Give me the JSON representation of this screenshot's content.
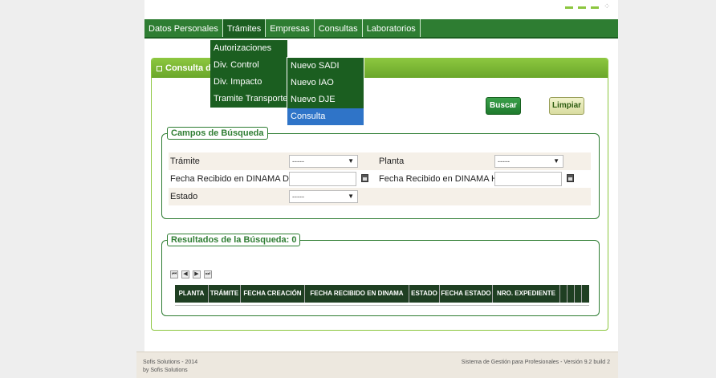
{
  "menu": {
    "items": [
      "Datos Personales",
      "Trámites",
      "Empresas",
      "Consultas",
      "Laboratorios"
    ]
  },
  "tramites_menu": [
    "Autorizaciones",
    "Div. Control",
    "Div. Impacto",
    "Tramite Transporte"
  ],
  "div_control_submenu": [
    "Nuevo SADI",
    "Nuevo IAO",
    "Nuevo DJE",
    "Consulta"
  ],
  "panel": {
    "title": "Consulta de T"
  },
  "buttons": {
    "buscar": "Buscar",
    "limpiar": "Limpiar"
  },
  "campos": {
    "legend": "Campos de Búsqueda",
    "tramite_label": "Trámite",
    "tramite_value": "-----",
    "planta_label": "Planta",
    "planta_value": "-----",
    "fecha_desde_label": "Fecha Recibido en DINAMA Desde",
    "fecha_hasta_label": "Fecha Recibido en DINAMA Hasta",
    "estado_label": "Estado",
    "estado_value": "-----"
  },
  "resultados": {
    "legend": "Resultados de la Búsqueda: 0",
    "pager": [
      "⏮",
      "◀",
      "▶",
      "⏭"
    ],
    "columns": [
      "PLANTA",
      "TRÁMITE",
      "FECHA CREACIÓN",
      "FECHA RECIBIDO EN DINAMA",
      "ESTADO",
      "FECHA ESTADO",
      "NRO. EXPEDIENTE"
    ]
  },
  "footer": {
    "left_line1": "Sofis Solutions - 2014",
    "left_line2": "by Sofis Solutions",
    "right": "Sistema de Gestión para Profesionales - Versión 9.2 build 2"
  },
  "colors": {
    "menu_bg": "#2e7d32",
    "accent": "#8cc63f",
    "highlight": "#2f74c8"
  }
}
